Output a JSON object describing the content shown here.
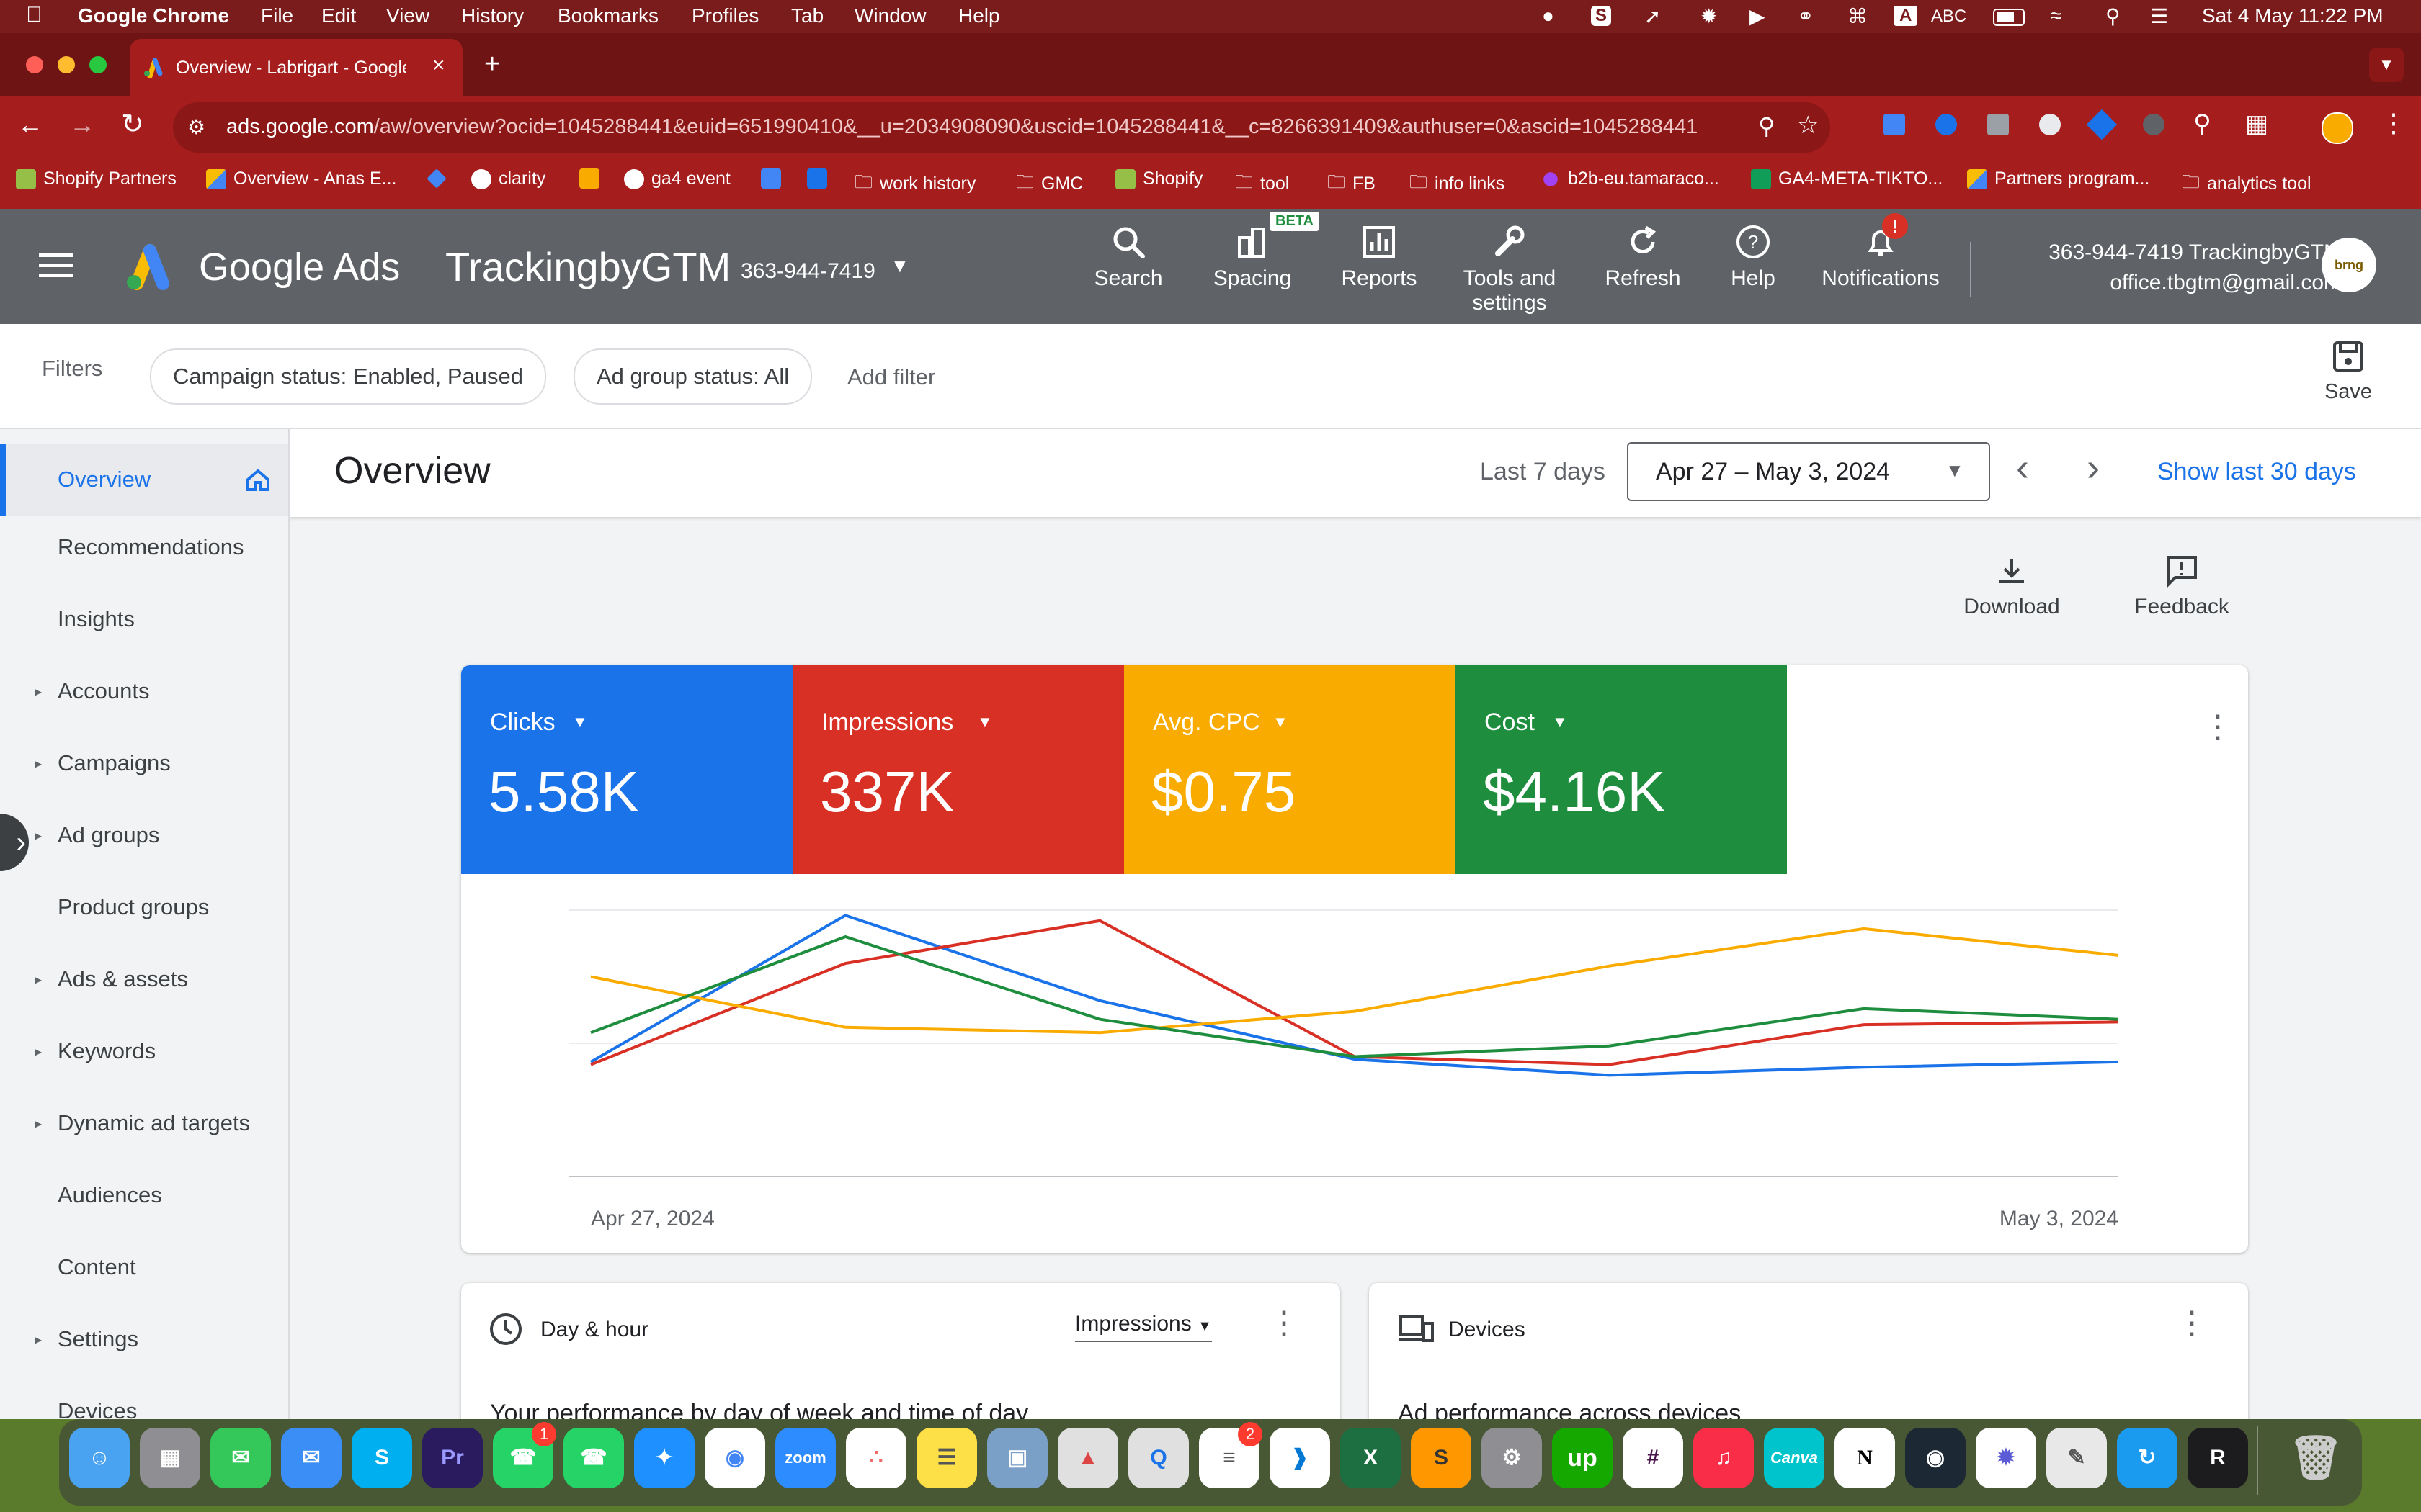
{
  "menubar": {
    "app": "Google Chrome",
    "menus": [
      "File",
      "Edit",
      "View",
      "History",
      "Bookmarks",
      "Profiles",
      "Tab",
      "Window",
      "Help"
    ],
    "input_badge": "A",
    "input_label": "ABC",
    "datetime": "Sat 4 May  11:22 PM"
  },
  "browser": {
    "tab_title": "Overview - Labrigart - Google",
    "url_host": "ads.google.com",
    "url_path": "/aw/overview?ocid=1045288441&euid=651990410&__u=2034908090&uscid=1045288441&__c=8266391409&authuser=0&ascid=1045288441",
    "bookmarks": [
      "Shopify Partners",
      "Overview - Anas E...",
      "clarity",
      "ga4 event",
      "work history",
      "GMC",
      "Shopify",
      "tool",
      "FB",
      "info links",
      "b2b-eu.tamaraco...",
      "GA4-META-TIKTO...",
      "Partners program...",
      "analytics tool"
    ]
  },
  "header": {
    "product": "Google Ads",
    "account_name": "TrackingbyGTM",
    "account_id": "363-944-7419",
    "nav": {
      "search": "Search",
      "spacing": "Spacing",
      "beta": "BETA",
      "reports": "Reports",
      "tools_1": "Tools and",
      "tools_2": "settings",
      "refresh": "Refresh",
      "help": "Help",
      "notifications": "Notifications",
      "notif_badge": "!"
    },
    "user_line1": "363-944-7419 TrackingbyGTM",
    "user_line2": "office.tbgtm@gmail.com",
    "avatar_text": "brng"
  },
  "filters": {
    "label": "Filters",
    "chips": [
      "Campaign status: Enabled, Paused",
      "Ad group status: All"
    ],
    "add_filter": "Add filter",
    "save": "Save"
  },
  "sidebar": {
    "items": [
      {
        "label": "Overview",
        "active": true
      },
      {
        "label": "Recommendations"
      },
      {
        "label": "Insights"
      },
      {
        "label": "Accounts",
        "expand": true
      },
      {
        "label": "Campaigns",
        "expand": true
      },
      {
        "label": "Ad groups",
        "expand": true
      },
      {
        "label": "Product groups"
      },
      {
        "label": "Ads & assets",
        "expand": true
      },
      {
        "label": "Keywords",
        "expand": true
      },
      {
        "label": "Dynamic ad targets",
        "expand": true
      },
      {
        "label": "Audiences"
      },
      {
        "label": "Content"
      },
      {
        "label": "Settings",
        "expand": true
      },
      {
        "label": "Devices"
      }
    ]
  },
  "overview": {
    "title": "Overview",
    "range_label": "Last 7 days",
    "date_range": "Apr 27 – May 3, 2024",
    "show_last": "Show last 30 days",
    "download": "Download",
    "feedback": "Feedback"
  },
  "metrics": [
    {
      "label": "Clicks",
      "value": "5.58K",
      "color": "#1a73e8"
    },
    {
      "label": "Impressions",
      "value": "337K",
      "color": "#d93025"
    },
    {
      "label": "Avg. CPC",
      "value": "$0.75",
      "color": "#f9ab00"
    },
    {
      "label": "Cost",
      "value": "$4.16K",
      "color": "#1e8e3e"
    }
  ],
  "chart_data": {
    "type": "line",
    "x": [
      "Apr 27, 2024",
      "Apr 28, 2024",
      "Apr 29, 2024",
      "Apr 30, 2024",
      "May 1, 2024",
      "May 2, 2024",
      "May 3, 2024"
    ],
    "x_tick_labels": [
      "Apr 27, 2024",
      "May 3, 2024"
    ],
    "normalized": true,
    "ylim": [
      0,
      100
    ],
    "grid": true,
    "series": [
      {
        "name": "Clicks",
        "color": "#1a73e8",
        "values": [
          43,
          98,
          66,
          44,
          38,
          41,
          43
        ]
      },
      {
        "name": "Impressions",
        "color": "#d93025",
        "values": [
          42,
          80,
          96,
          45,
          42,
          57,
          58
        ]
      },
      {
        "name": "Avg. CPC",
        "color": "#f9ab00",
        "values": [
          75,
          56,
          54,
          62,
          79,
          93,
          83
        ]
      },
      {
        "name": "Cost",
        "color": "#1e8e3e",
        "values": [
          54,
          90,
          59,
          45,
          49,
          63,
          59
        ]
      }
    ]
  },
  "cards": {
    "dayhour_title": "Day & hour",
    "dayhour_metric": "Impressions",
    "dayhour_sub": "Your performance by day of week and time of day",
    "devices_title": "Devices",
    "devices_sub": "Ad performance across devices"
  },
  "dock": {
    "zoom": "zoom",
    "canva": "Canva",
    "upwork": "up",
    "notion": "N",
    "r": "R",
    "skype": "S",
    "premiere": "Pr",
    "whatsapp_badge": "1",
    "reminders_badge": "2"
  }
}
